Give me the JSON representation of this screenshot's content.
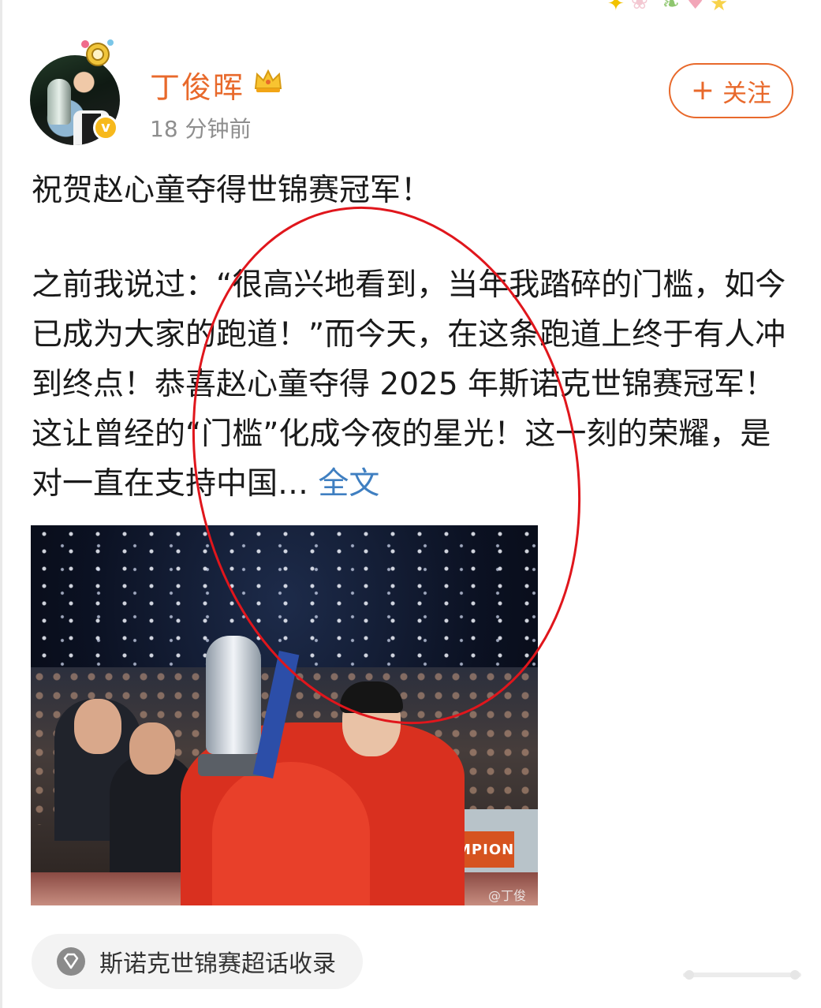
{
  "post": {
    "author_name": "丁俊晖",
    "timestamp": "18 分钟前",
    "follow_label": "关注",
    "follow_plus": "+",
    "title_line": "祝贺赵心童夺得世锦赛冠军！",
    "body_text": "之前我说过：“很高兴地看到，当年我踏碎的门槛，如今已成为大家的跑道！”而今天，在这条跑道上终于有人冲到终点！恭喜赵心童夺得 2025 年斯诺克世锦赛冠军！这让曾经的“门槛”化成今夜的星光！这一刻的荣耀，是对一直在支持中国…",
    "more_label": "全文",
    "image": {
      "banner_text": "CHAMPION",
      "watermark": "@丁俊晖"
    },
    "topic_label": "斯诺克世锦赛超话收录"
  },
  "colors": {
    "accent": "#e8692b",
    "link": "#3f7fc1",
    "annotation_circle": "#e0161c",
    "verified": "#f7b91c"
  },
  "icons": [
    "avatar-sticker-icon",
    "crown-icon",
    "verified-icon",
    "plus-icon",
    "topic-diamond-icon",
    "home-indicator"
  ]
}
